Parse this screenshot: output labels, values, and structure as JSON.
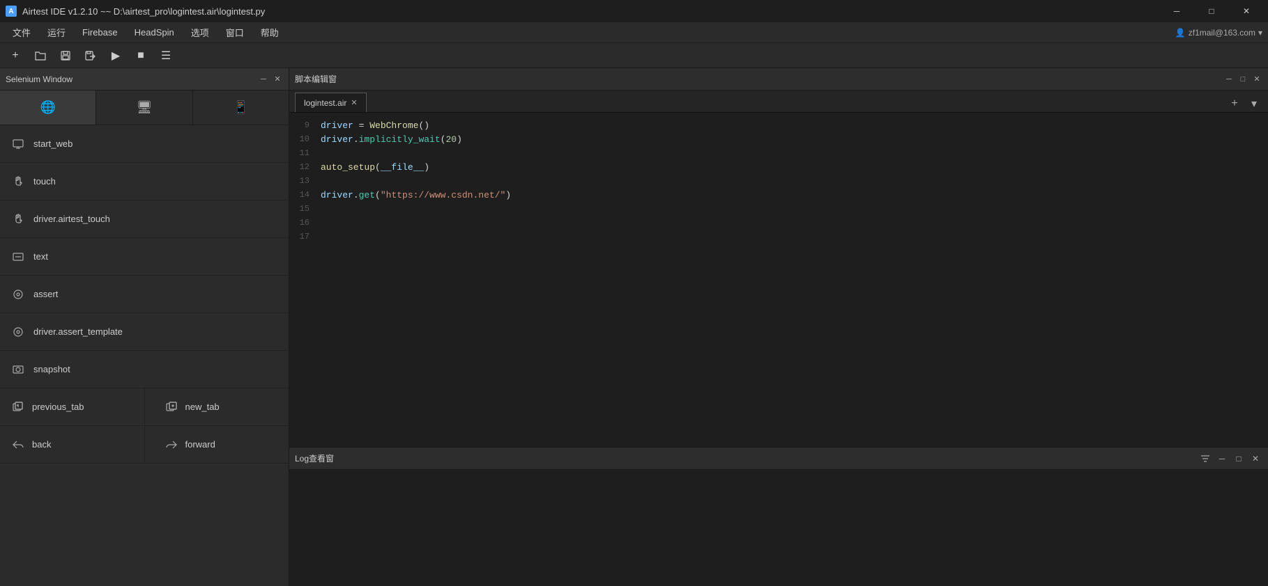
{
  "titlebar": {
    "title": "Airtest IDE v1.2.10 ~~ D:\\airtest_pro\\logintest.air\\logintest.py",
    "app_name": "Airtest IDE v1.2.10",
    "path": "D:\\airtest_pro\\logintest.air\\logintest.py",
    "minimize_label": "─",
    "maximize_label": "□",
    "close_label": "✕"
  },
  "menubar": {
    "items": [
      "文件",
      "运行",
      "Firebase",
      "HeadSpin",
      "选项",
      "窗口",
      "帮助"
    ],
    "user": "zf1mail@163.com"
  },
  "toolbar": {
    "buttons": [
      {
        "icon": "+",
        "name": "new",
        "label": "新建"
      },
      {
        "icon": "📂",
        "name": "open",
        "label": "打开"
      },
      {
        "icon": "💾",
        "name": "save",
        "label": "保存"
      },
      {
        "icon": "📋",
        "name": "saveas",
        "label": "另存为"
      },
      {
        "icon": "▶",
        "name": "run",
        "label": "运行"
      },
      {
        "icon": "■",
        "name": "stop",
        "label": "停止"
      },
      {
        "icon": "☰",
        "name": "menu",
        "label": "菜单"
      }
    ]
  },
  "left_panel": {
    "title": "Selenium Window",
    "minimize_icon": "─",
    "close_icon": "✕",
    "device_tabs": [
      {
        "icon": "🌐",
        "name": "web"
      },
      {
        "icon": "🖥",
        "name": "screen"
      },
      {
        "icon": "📱",
        "name": "mobile"
      }
    ],
    "api_items": [
      {
        "icon": "✉",
        "label": "start_web",
        "type": "single"
      },
      {
        "icon": "✋",
        "label": "touch",
        "type": "single"
      },
      {
        "icon": "✋",
        "label": "driver.airtest_touch",
        "type": "single"
      },
      {
        "icon": "T",
        "label": "text",
        "type": "single"
      },
      {
        "icon": "⊙",
        "label": "assert",
        "type": "single"
      },
      {
        "icon": "⊙",
        "label": "driver.assert_template",
        "type": "single"
      },
      {
        "icon": "📷",
        "label": "snapshot",
        "type": "single"
      },
      {
        "icon_left": "⊞",
        "label_left": "previous_tab",
        "icon_right": "⊞",
        "label_right": "new_tab",
        "type": "double"
      },
      {
        "icon_left": "↩",
        "label_left": "back",
        "icon_right": "↪",
        "label_right": "forward",
        "type": "double"
      }
    ]
  },
  "script_editor": {
    "title": "脚本编辑窗",
    "tab_name": "logintest.air",
    "tab_close": "✕",
    "add_tab_icon": "+",
    "dropdown_icon": "▾",
    "minimize_icon": "─",
    "maximize_icon": "□",
    "close_icon": "✕",
    "code_lines": [
      {
        "num": 9,
        "content": "driver = WebChrome()"
      },
      {
        "num": 10,
        "content": "driver.implicitly_wait(20)"
      },
      {
        "num": 11,
        "content": ""
      },
      {
        "num": 12,
        "content": "auto_setup(__file__)"
      },
      {
        "num": 13,
        "content": ""
      },
      {
        "num": 14,
        "content": "driver.get(\"https://www.csdn.net/\")"
      },
      {
        "num": 15,
        "content": ""
      },
      {
        "num": 16,
        "content": ""
      },
      {
        "num": 17,
        "content": ""
      }
    ]
  },
  "log_panel": {
    "title": "Log查看窗",
    "filter_icon": "▼",
    "minimize_icon": "─",
    "maximize_icon": "□",
    "close_icon": "✕"
  }
}
